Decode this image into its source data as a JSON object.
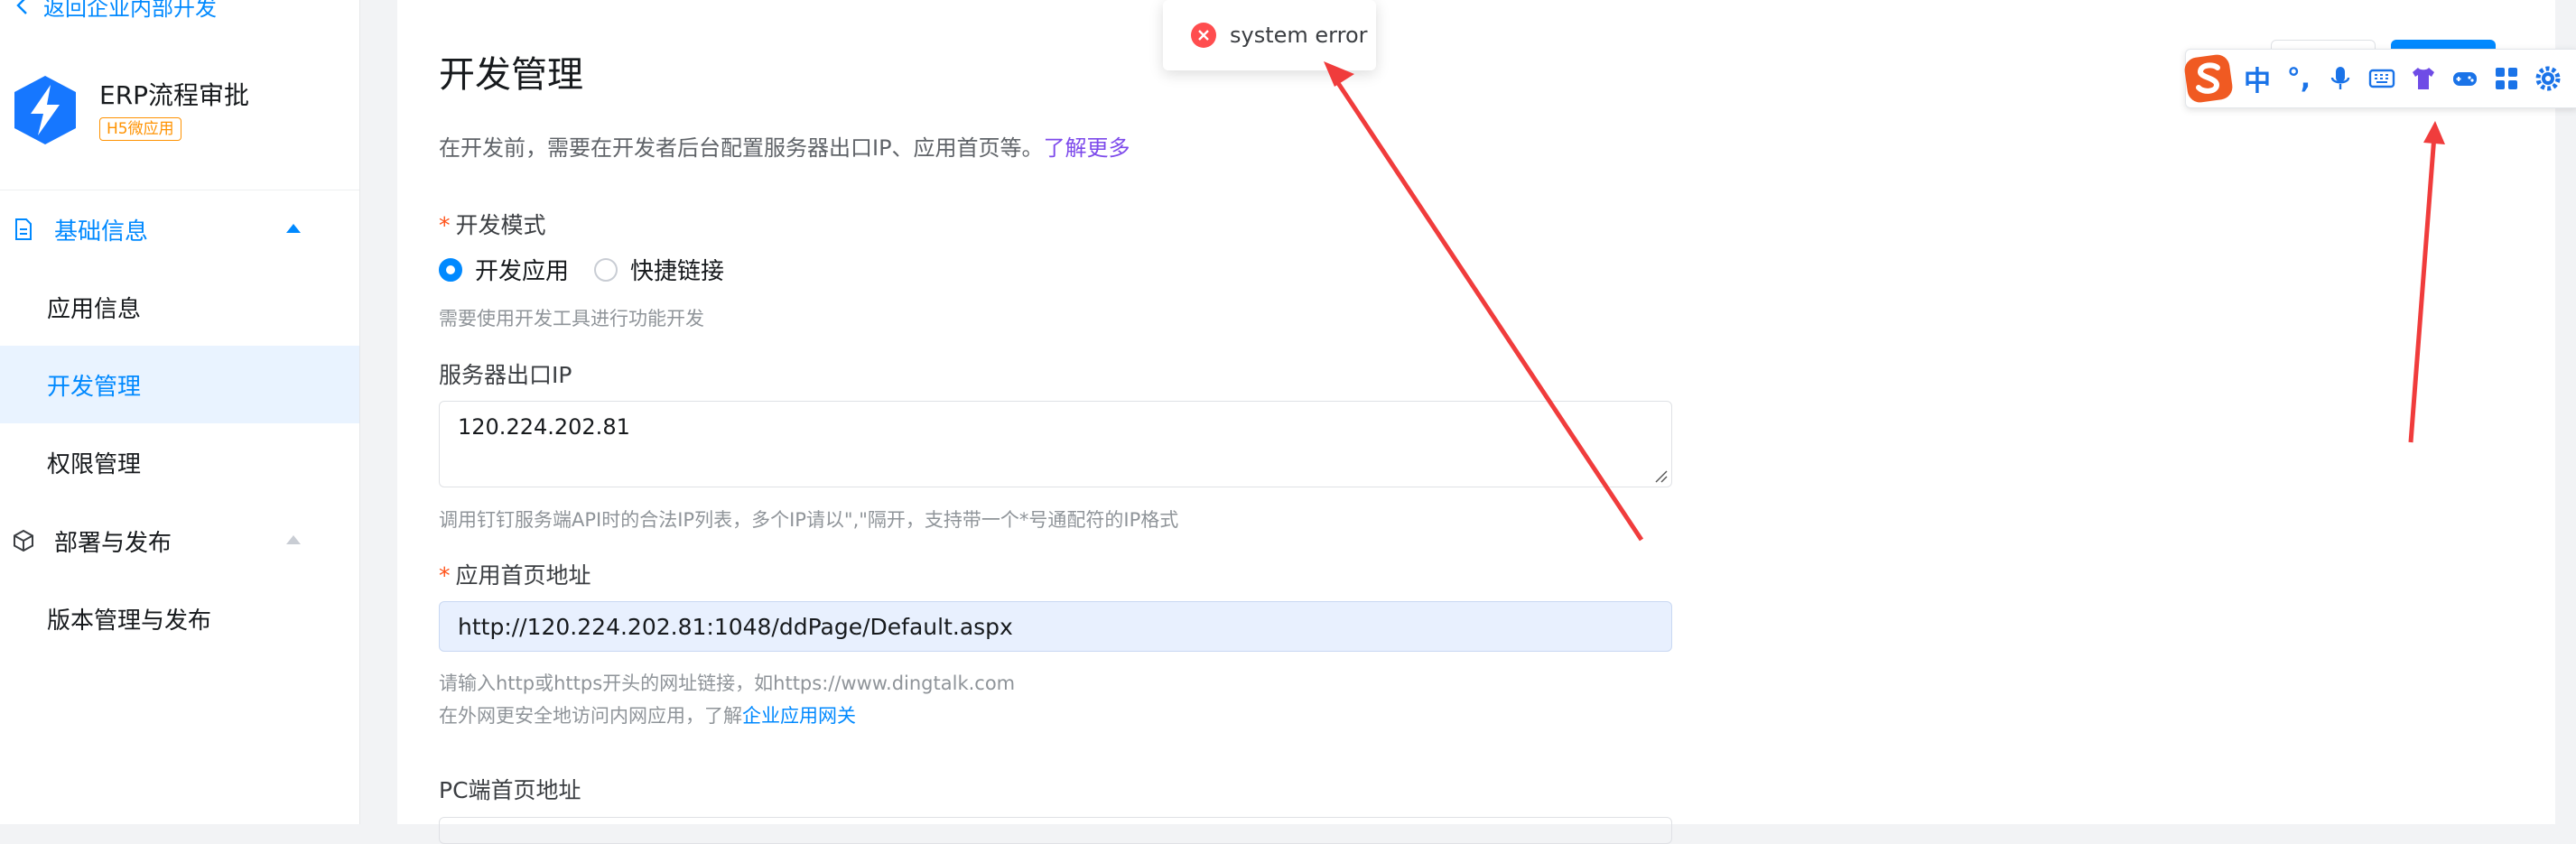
{
  "sidebar": {
    "back_label": "返回企业内部开发",
    "app": {
      "name": "ERP流程审批",
      "badge": "H5微应用"
    },
    "groups": [
      {
        "label": "基础信息",
        "items": [
          "应用信息",
          "开发管理",
          "权限管理"
        ]
      },
      {
        "label": "部署与发布",
        "items": [
          "版本管理与发布"
        ]
      }
    ],
    "active_item": "开发管理"
  },
  "main": {
    "title": "开发管理",
    "intro_text": "在开发前，需要在开发者后台配置服务器出口IP、应用首页等。",
    "intro_link": "了解更多",
    "dev_mode": {
      "required_mark": "*",
      "label": "开发模式",
      "options": [
        "开发应用",
        "快捷链接"
      ],
      "selected": "开发应用",
      "hint": "需要使用开发工具进行功能开发"
    },
    "server_ip": {
      "label": "服务器出口IP",
      "value": "120.224.202.81",
      "hint": "调用钉钉服务端API时的合法IP列表，多个IP请以\",\"隔开，支持带一个*号通配符的IP格式"
    },
    "homepage": {
      "required_mark": "*",
      "label": "应用首页地址",
      "value": "http://120.224.202.81:1048/ddPage/Default.aspx",
      "hint1": "请输入http或https开头的网址链接，如https://www.dingtalk.com",
      "hint2_text": "在外网更安全地访问内网应用，了解",
      "hint2_link": "企业应用网关"
    },
    "pc_homepage": {
      "label": "PC端首页地址"
    }
  },
  "toast": {
    "message": "system error"
  },
  "ime": {
    "zh_label": "中",
    "punct_label": "°,"
  },
  "colors": {
    "primary": "#0089ff",
    "active_bg": "#e9f3ff",
    "required": "#ff5219",
    "badge": "#ff9200",
    "link_purple": "#7d4aeb",
    "error": "#ff4d4f",
    "arrow": "#f03c3c",
    "ime_blue": "#1a73e8",
    "ime_logo": "#f05a22"
  }
}
